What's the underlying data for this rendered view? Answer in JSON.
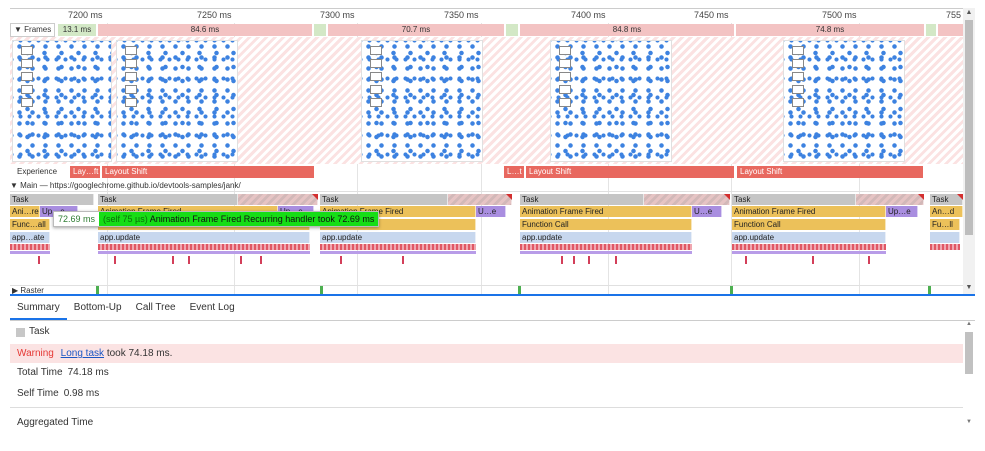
{
  "timeline": {
    "ruler_ticks": [
      "7200 ms",
      "7250 ms",
      "7300 ms",
      "7350 ms",
      "7400 ms",
      "7450 ms",
      "7500 ms",
      "755"
    ],
    "frames": {
      "label": "▼ Frames",
      "segments": [
        "13.1 ms",
        "84.6 ms",
        "70.7 ms",
        "84.8 ms",
        "74.8 ms"
      ]
    },
    "experience": {
      "label": "Experience",
      "shifts": [
        "Lay…ft",
        "Layout Shift",
        "L…t",
        "Layout Shift",
        "Layout Shift"
      ]
    },
    "main_header": "▼ Main — https://googlechrome.github.io/devtools-samples/jank/",
    "flame": {
      "task": "Task",
      "animation_frame": "Animation Frame Fired",
      "anim_short_a": "Ani…red",
      "anim_short_b": "An…d",
      "update_short_a": "Up…e",
      "update_short_b": "U…e",
      "function_call": "Function Call",
      "func_short_a": "Func…all",
      "func_short_b": "Fu…ll",
      "app_update": "app.update",
      "app_update_short": "app…ate"
    },
    "tooltip": {
      "time": "72.69 ms",
      "self": "(self 75 µs)",
      "description": "Animation Frame Fired  Recurring handler took 72.69 ms"
    },
    "raster_label": "▶ Raster"
  },
  "tabs": [
    "Summary",
    "Bottom-Up",
    "Call Tree",
    "Event Log"
  ],
  "summary": {
    "title": "Task",
    "warning_label": "Warning",
    "warning_link": "Long task",
    "warning_rest": "took 74.18 ms.",
    "total_time_label": "Total Time",
    "total_time_value": "74.18 ms",
    "self_time_label": "Self Time",
    "self_time_value": "0.98 ms",
    "aggregated_label": "Aggregated Time"
  },
  "colors": {
    "accent": "#1a73e8",
    "layout_shift": "#e8685f",
    "animation_frame": "#ecc15a",
    "app_update": "#c7d7ee",
    "tooltip_green": "#16dd16",
    "warning_bg": "#fbe3e3"
  },
  "icons": [
    "scroll-up-icon",
    "scroll-down-icon",
    "task-swatch-icon",
    "expand-triangle-icon"
  ]
}
